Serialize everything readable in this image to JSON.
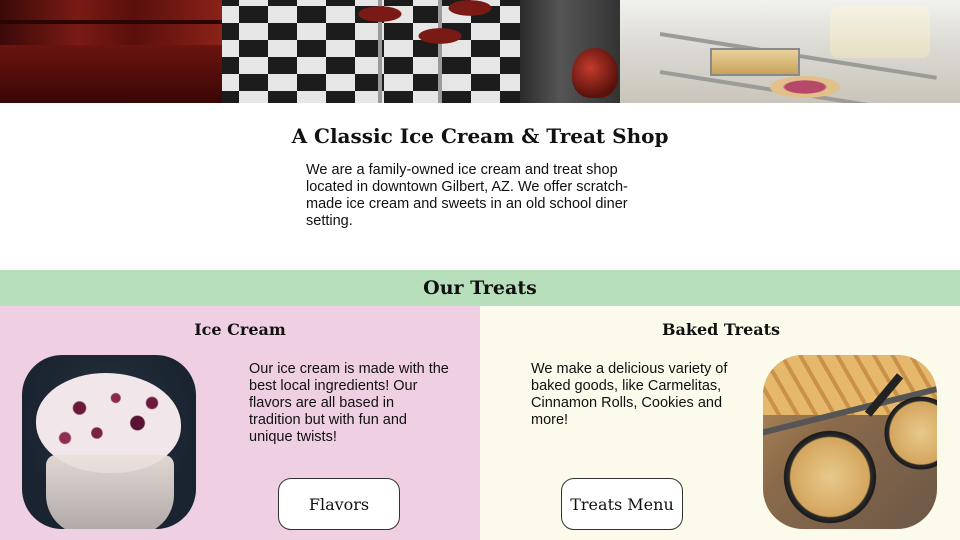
{
  "intro": {
    "title": "A Classic Ice Cream & Treat Shop",
    "text": "We are a family-owned ice cream and treat shop located in downtown Gilbert, AZ. We offer scratch-made ice cream and sweets in an old school diner setting."
  },
  "treats": {
    "heading": "Our Treats",
    "ice_cream": {
      "title": "Ice Cream",
      "text": "Our ice cream is made with the best local ingredients! Our flavors are all based in tradition but with fun and unique twists!",
      "button": "Flavors"
    },
    "baked": {
      "title": "Baked Treats",
      "text": "We make a delicious variety of baked goods, like Carmelitas, Cinnamon Rolls, Cookies and more!",
      "button": "Treats Menu"
    }
  },
  "colors": {
    "band": "#b8dfbb",
    "left_panel": "#efd0e2",
    "right_panel": "#fbfaeb"
  }
}
